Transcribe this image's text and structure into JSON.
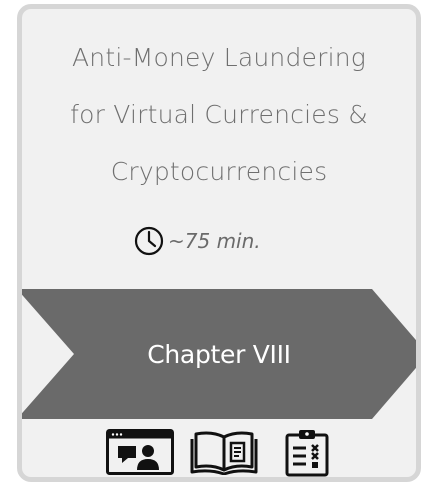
{
  "course": {
    "title_lines": [
      "Anti-Money Laundering",
      "for Virtual Currencies &",
      "Cryptocurrencies"
    ],
    "duration": "~75 min.",
    "chapter": "Chapter VIII"
  },
  "icons": {
    "clock": "clock-icon",
    "video": "video-presentation-icon",
    "book": "open-book-icon",
    "quiz": "quiz-checklist-icon"
  },
  "colors": {
    "card_background": "#f1f1f1",
    "card_border": "#d6d6d6",
    "banner": "#6a6a6a",
    "title_text": "#6f6f6f"
  }
}
